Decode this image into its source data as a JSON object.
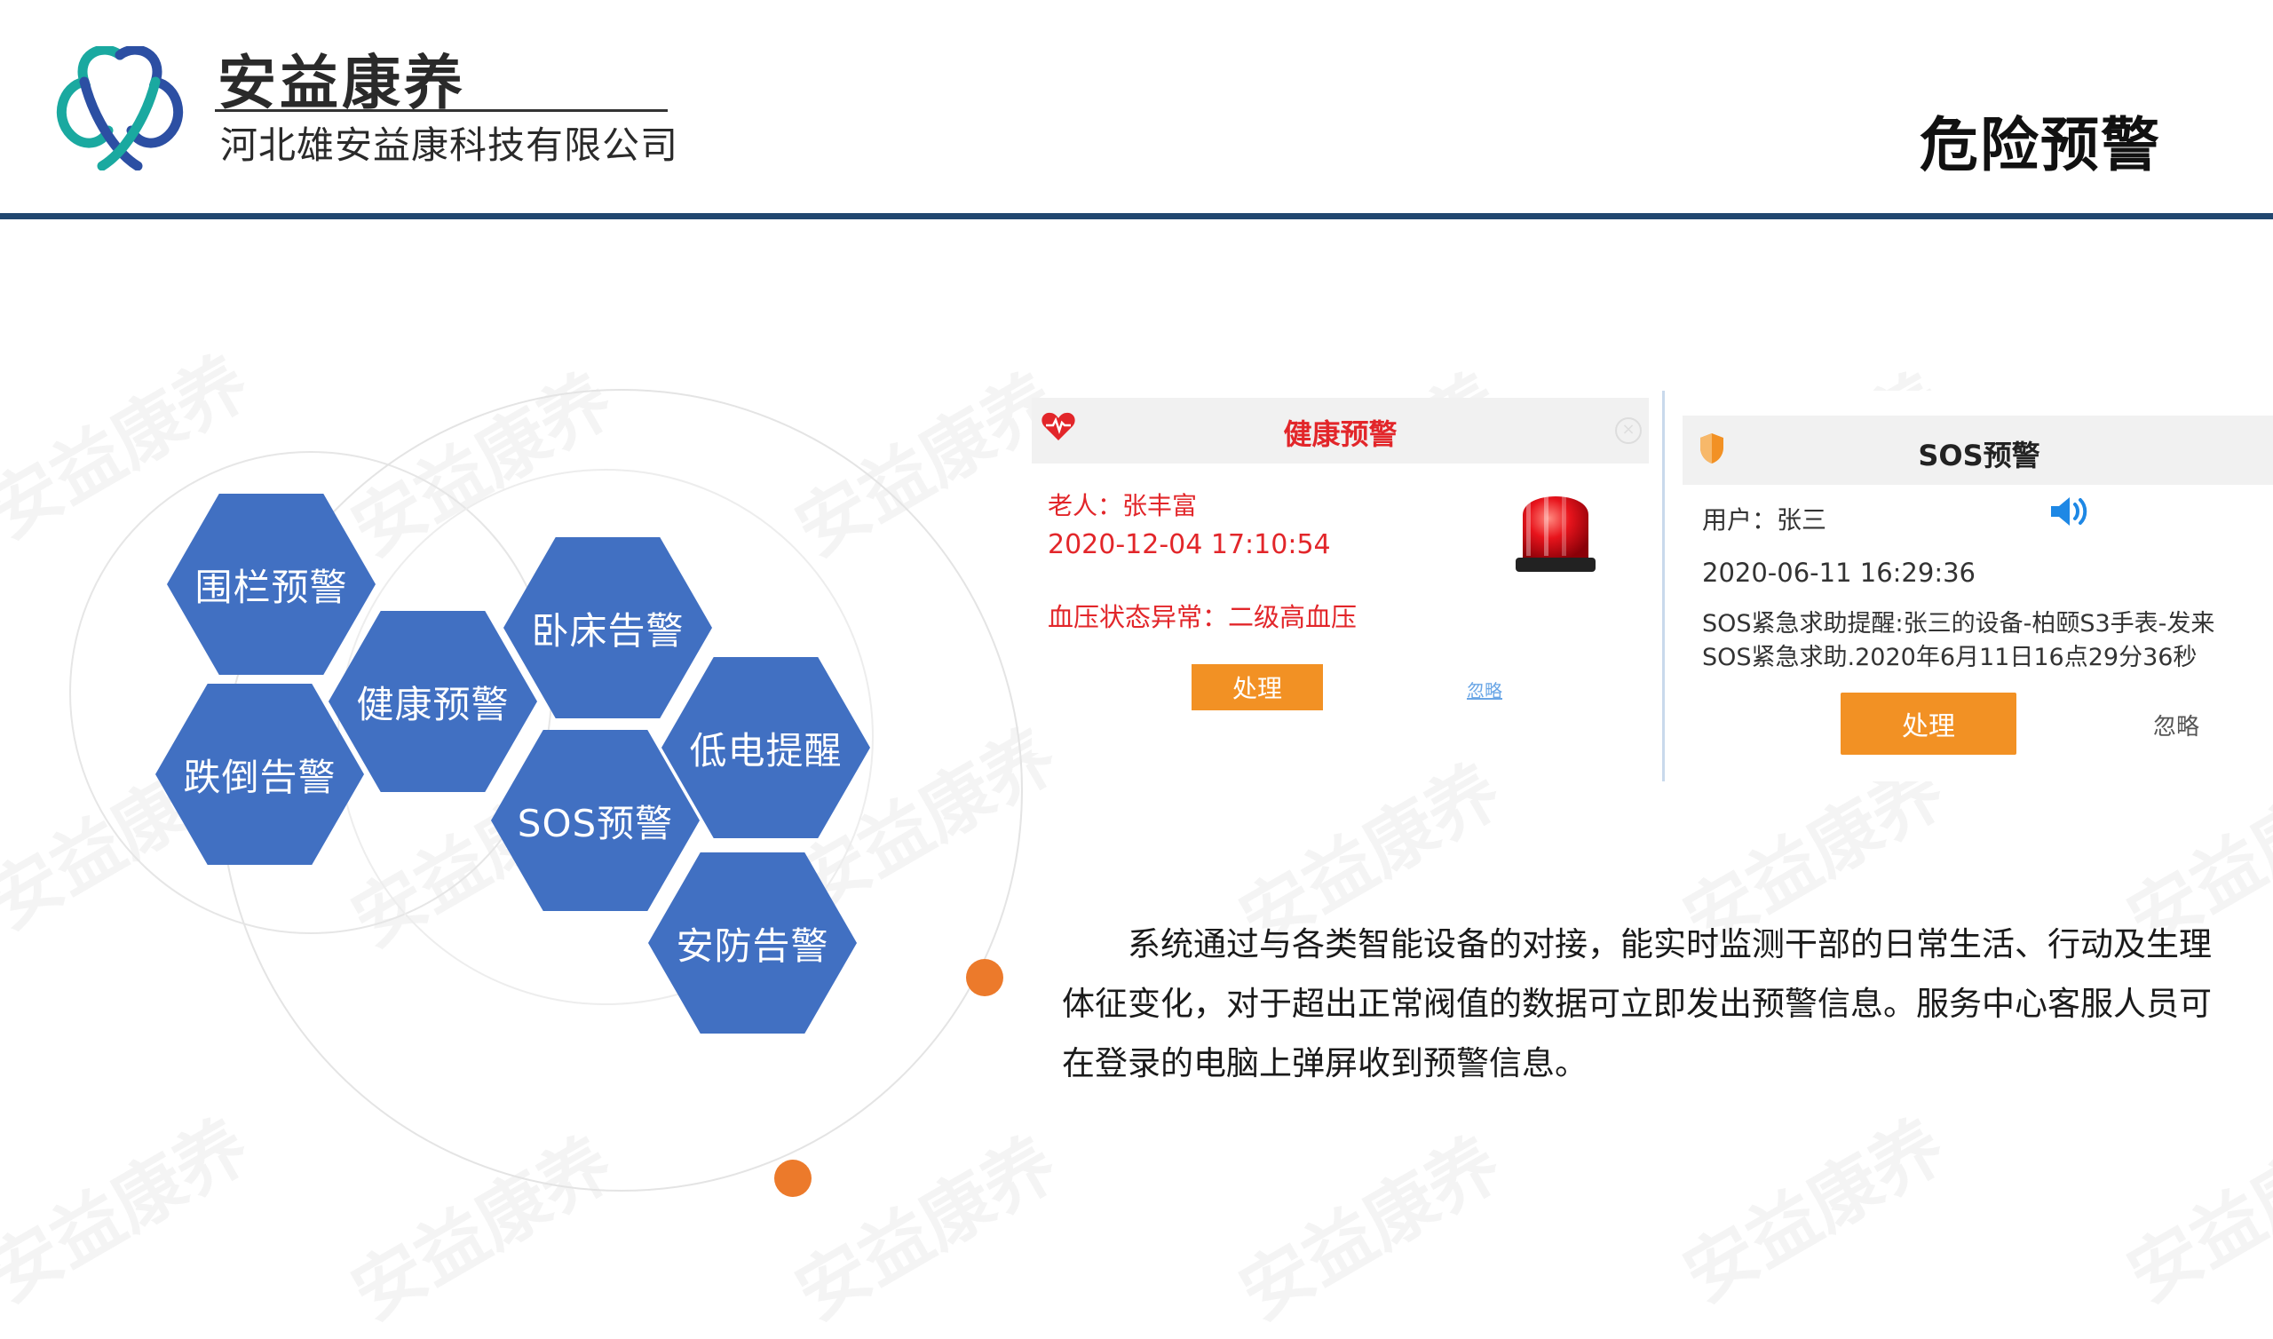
{
  "header": {
    "brand_name": "安益康养",
    "company": "河北雄安益康科技有限公司",
    "page_title": "危险预警"
  },
  "watermark": "安益康养",
  "features": [
    {
      "label": "围栏预警"
    },
    {
      "label": "卧床告警"
    },
    {
      "label": "健康预警"
    },
    {
      "label": "跌倒告警"
    },
    {
      "label": "低电提醒"
    },
    {
      "label": "SOS预警"
    },
    {
      "label": "安防告警"
    }
  ],
  "health_popup": {
    "title": "健康预警",
    "elder": "老人：张丰富",
    "time": "2020-12-04 17:10:54",
    "status": "血压状态异常：二级高血压",
    "handle_button": "处理",
    "ignore_link": "忽略"
  },
  "sos_popup": {
    "title": "SOS预警",
    "user": "用户：张三",
    "time": "2020-06-11 16:29:36",
    "message": "SOS紧急求助提醒:张三的设备-柏颐S3手表-发来SOS紧急求助.2020年6月11日16点29分36秒",
    "handle_button": "处理",
    "ignore_button": "忽略"
  },
  "description": "系统通过与各类智能设备的对接，能实时监测干部的日常生活、行动及生理体征变化，对于超出正常阀值的数据可立即发出预警信息。服务中心客服人员可在登录的电脑上弹屏收到预警信息。",
  "colors": {
    "hexagon": "#4170c2",
    "accent_orange": "#ec7a2b",
    "alert_red": "#e2262a",
    "button_orange": "#f29124",
    "header_rule": "#21476f"
  }
}
